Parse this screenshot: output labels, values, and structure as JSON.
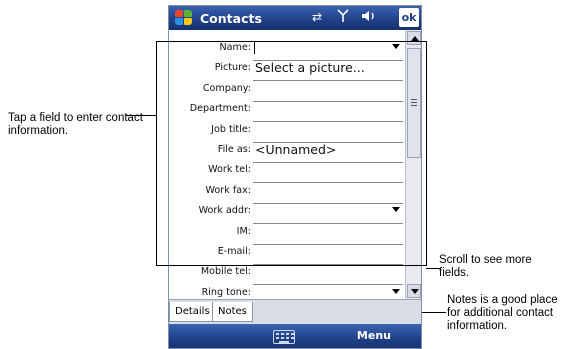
{
  "callouts": {
    "tap_field": "Tap a field to enter contact information.",
    "scroll": "Scroll to see more fields.",
    "notes": "Notes is a good place for additional contact information."
  },
  "titlebar": {
    "title": "Contacts",
    "ok_label": "ok"
  },
  "fields": [
    {
      "label": "Name:",
      "value": "",
      "dropdown": true,
      "cursor": true
    },
    {
      "label": "Picture:",
      "value": "Select a picture..."
    },
    {
      "label": "Company:",
      "value": ""
    },
    {
      "label": "Department:",
      "value": ""
    },
    {
      "label": "Job title:",
      "value": ""
    },
    {
      "label": "File as:",
      "value": "<Unnamed>"
    },
    {
      "label": "Work tel:",
      "value": ""
    },
    {
      "label": "Work fax:",
      "value": ""
    },
    {
      "label": "Work addr:",
      "value": "",
      "dropdown": true
    },
    {
      "label": "IM:",
      "value": ""
    },
    {
      "label": "E-mail:",
      "value": ""
    },
    {
      "label": "Mobile tel:",
      "value": ""
    },
    {
      "label": "Ring tone:",
      "value": "",
      "dropdown": true
    }
  ],
  "tabs": {
    "details": "Details",
    "notes": "Notes"
  },
  "softkeys": {
    "right": "Menu"
  },
  "icons": [
    "windows-start-icon",
    "connectivity-icon",
    "signal-icon",
    "volume-icon",
    "keyboard-icon"
  ]
}
